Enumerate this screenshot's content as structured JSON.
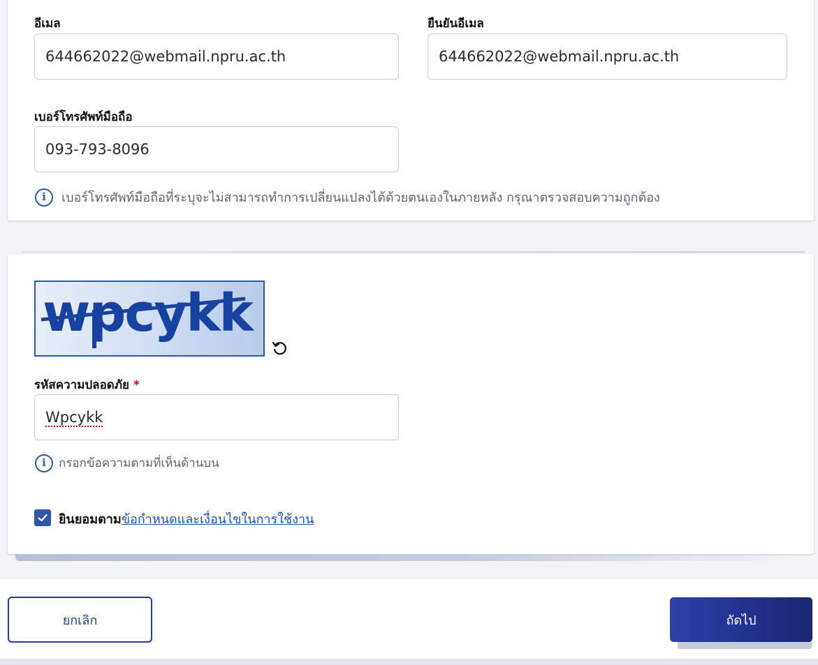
{
  "contact": {
    "email_label": "อีเมล",
    "email_value": "644662022@webmail.npru.ac.th",
    "confirm_email_label": "ยืนยันอีเมล",
    "confirm_email_value": "644662022@webmail.npru.ac.th",
    "phone_label": "เบอร์โทรศัพท์มือถือ",
    "phone_value": "093-793-8096",
    "phone_hint": "เบอร์โทรศัพท์มือถือที่ระบุจะไม่สามารถทำการเปลี่ยนแปลงได้ด้วยตนเองในภายหลัง กรุณาตรวจสอบความถูกต้อง"
  },
  "security": {
    "captcha_text": "wpcykk",
    "refresh_icon": "refresh-icon",
    "code_label": "รหัสความปลอดภัย",
    "required_mark": "*",
    "code_value": "Wpcykk",
    "code_hint": "กรอกข้อความตามที่เห็นด้านบน",
    "terms_checked": true,
    "terms_prefix": "ยินยอมตาม",
    "terms_link": "ข้อกำหนดและเงื่อนไขในการใช้งาน"
  },
  "actions": {
    "cancel_label": "ยกเลิก",
    "next_label": "ถัดไป"
  },
  "colors": {
    "primary": "#233f8a",
    "link": "#1f4fb0",
    "required": "#d0021b"
  }
}
